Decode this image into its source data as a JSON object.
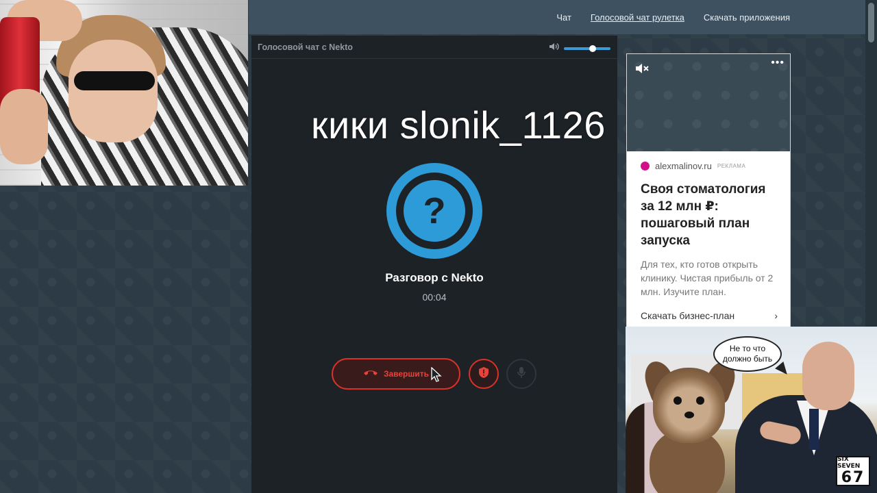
{
  "nav": {
    "items": [
      {
        "label": "Чат"
      },
      {
        "label": "Голосовой чат рулетка",
        "active": true
      },
      {
        "label": "Скачать приложения"
      }
    ]
  },
  "call": {
    "header_title": "Голосовой чат с Nekto",
    "avatar_symbol": "?",
    "talk_title": "Разговор с Nekto",
    "timer": "00:04",
    "end_label": "Завершить",
    "accent_color": "#2e9bd9",
    "danger_color": "#d9322b",
    "volume_level": 0.62
  },
  "overlay": {
    "caption": "кики slonik_1126"
  },
  "ad": {
    "source": "alexmalinov.ru",
    "tag": "РЕКЛАМА",
    "title": "Своя стоматология за 12 млн ₽: пошаговый план запуска",
    "text": "Для тех, кто готов открыть клинику. Чистая прибыль от 2 млн. Изучите план.",
    "link_label": "Скачать бизнес-план",
    "link_arrow": "›",
    "menu_symbol": "•••"
  },
  "meme": {
    "bubble": "Не то что должно быть",
    "badge_top": "SIX SEVEN",
    "badge_num": "67"
  }
}
